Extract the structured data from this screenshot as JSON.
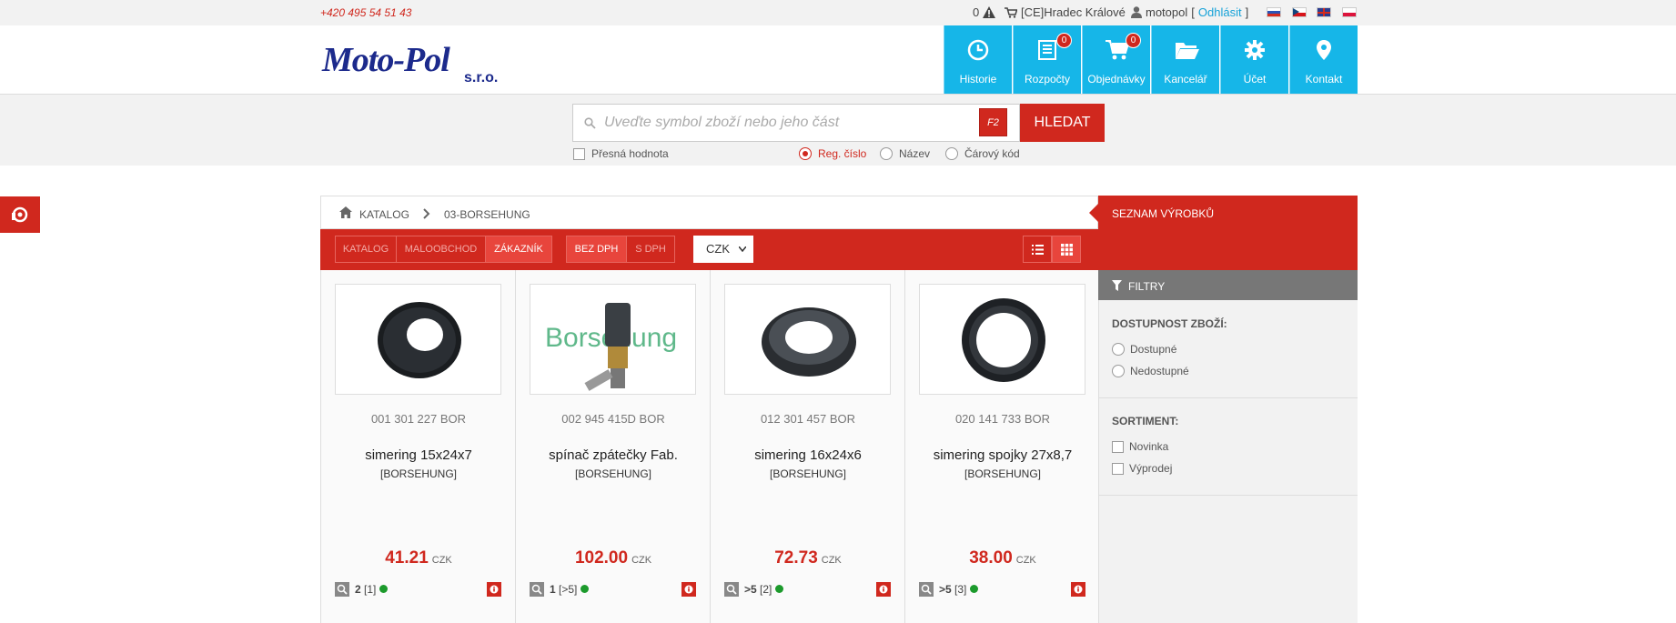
{
  "topbar": {
    "phone": "+420 495 54 51 43",
    "alerts_count": "0",
    "branch": "[CE]Hradec Králové",
    "user": "motopol",
    "logout_open": "[",
    "logout": "Odhlásit",
    "logout_close": "]"
  },
  "logo": {
    "text": "Moto-Pol",
    "suffix": "s.r.o."
  },
  "nav": [
    {
      "label": "Historie",
      "icon": "clock-icon"
    },
    {
      "label": "Rozpočty",
      "icon": "list-icon",
      "badge": "0"
    },
    {
      "label": "Objednávky",
      "icon": "cart-icon",
      "badge": "0"
    },
    {
      "label": "Kancelář",
      "icon": "folder-icon"
    },
    {
      "label": "Účet",
      "icon": "gear-icon"
    },
    {
      "label": "Kontakt",
      "icon": "location-icon"
    }
  ],
  "search": {
    "placeholder": "Uveďte symbol zboží nebo jeho část",
    "value": "",
    "hotkey": "F2",
    "button": "HLEDAT",
    "exact_label": "Přesná hodnota",
    "modes": [
      "Reg. číslo",
      "Název",
      "Čárový kód"
    ],
    "selected_mode": "Reg. číslo"
  },
  "breadcrumb": {
    "root": "KATALOG",
    "current": "03-BORSEHUNG"
  },
  "sidebar_title": "SEZNAM VÝROBKŮ",
  "toolbar": {
    "price_types": [
      "KATALOG",
      "MALOOBCHOD",
      "ZÁKAZNÍK"
    ],
    "selected_price_type": "ZÁKAZNÍK",
    "vat": [
      "BEZ DPH",
      "S DPH"
    ],
    "selected_vat": "BEZ DPH",
    "currency": "CZK"
  },
  "products": [
    {
      "code": "001 301 227 BOR",
      "name": "simering 15x24x7",
      "brand": "[BORSEHUNG]",
      "price": "41.21",
      "currency": "CZK",
      "stock_a": "2",
      "stock_b": "[1]"
    },
    {
      "code": "002 945 415D BOR",
      "name": "spínač zpátečky Fab.",
      "brand": "[BORSEHUNG]",
      "price": "102.00",
      "currency": "CZK",
      "stock_a": "1",
      "stock_b": "[>5]",
      "image_text": "Borsehung"
    },
    {
      "code": "012 301 457 BOR",
      "name": "simering 16x24x6",
      "brand": "[BORSEHUNG]",
      "price": "72.73",
      "currency": "CZK",
      "stock_a": ">5",
      "stock_b": "[2]"
    },
    {
      "code": "020 141 733 BOR",
      "name": "simering spojky 27x8,7",
      "brand": "[BORSEHUNG]",
      "price": "38.00",
      "currency": "CZK",
      "stock_a": ">5",
      "stock_b": "[3]"
    }
  ],
  "filters": {
    "title": "FILTRY",
    "availability_title": "DOSTUPNOST ZBOŽÍ:",
    "availability": [
      "Dostupné",
      "Nedostupné"
    ],
    "assortment_title": "SORTIMENT:",
    "assortment": [
      "Novinka",
      "Výprodej"
    ]
  },
  "colors": {
    "accent": "#d0281e",
    "nav": "#16b6e8",
    "in_stock": "#1c9a2c"
  }
}
